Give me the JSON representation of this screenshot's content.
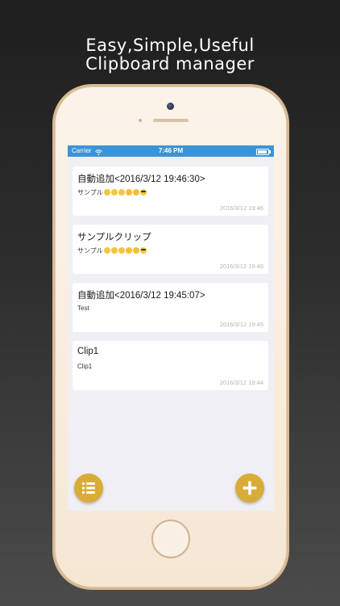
{
  "headline": {
    "line1": "Easy,Simple,Useful",
    "line2": "Clipboard manager"
  },
  "statusbar": {
    "carrier": "Carrier",
    "time": "7:46 PM"
  },
  "clips": [
    {
      "title": "自動追加<2016/3/12 19:46:30>",
      "body": "サンプル",
      "emoji": true,
      "date": "2016/3/12 19:46"
    },
    {
      "title": "サンプルクリップ",
      "body": "サンプル",
      "emoji": true,
      "date": "2016/3/12 19:46"
    },
    {
      "title": "自動追加<2016/3/12 19:45:07>",
      "body": "Test",
      "emoji": false,
      "date": "2016/3/12 19:45"
    },
    {
      "title": "Clip1",
      "body": "Clip1",
      "emoji": false,
      "date": "2016/3/12 19:44"
    }
  ],
  "icons": {
    "list_button": "list-icon",
    "add_button": "plus-icon"
  },
  "colors": {
    "statusbar": "#3a94d8",
    "accent": "#d9ac37",
    "background": "#efeff4"
  }
}
